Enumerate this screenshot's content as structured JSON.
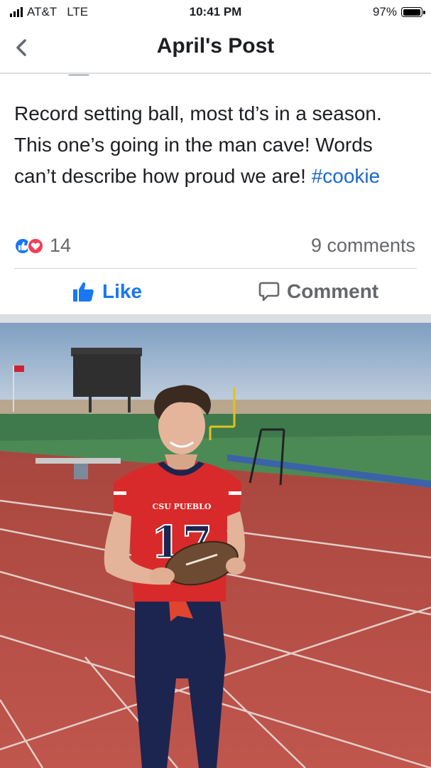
{
  "status_bar": {
    "carrier": "AT&T",
    "network": "LTE",
    "time": "10:41 PM",
    "battery_percent_label": "97%",
    "battery_level": 0.97
  },
  "nav": {
    "back_icon": "chevron-left-icon",
    "title": "April's Post"
  },
  "post": {
    "text": "Record setting ball, most td’s in a season. This one’s going in the man cave! Words can’t describe how proud we are! ",
    "hashtag": "#cookie",
    "reactions": {
      "icons": [
        "like-reaction-icon",
        "love-reaction-icon"
      ],
      "count": "14"
    },
    "comments_count": "9 comments",
    "actions": {
      "like_label": "Like",
      "comment_label": "Comment"
    }
  },
  "photo": {
    "jersey_team_text": "CSU PUEBLO",
    "jersey_number": "17"
  },
  "colors": {
    "link_blue": "#1a67d2",
    "like_blue": "#1877f2",
    "love_red": "#f33e58",
    "secondary_text": "#65676b"
  }
}
